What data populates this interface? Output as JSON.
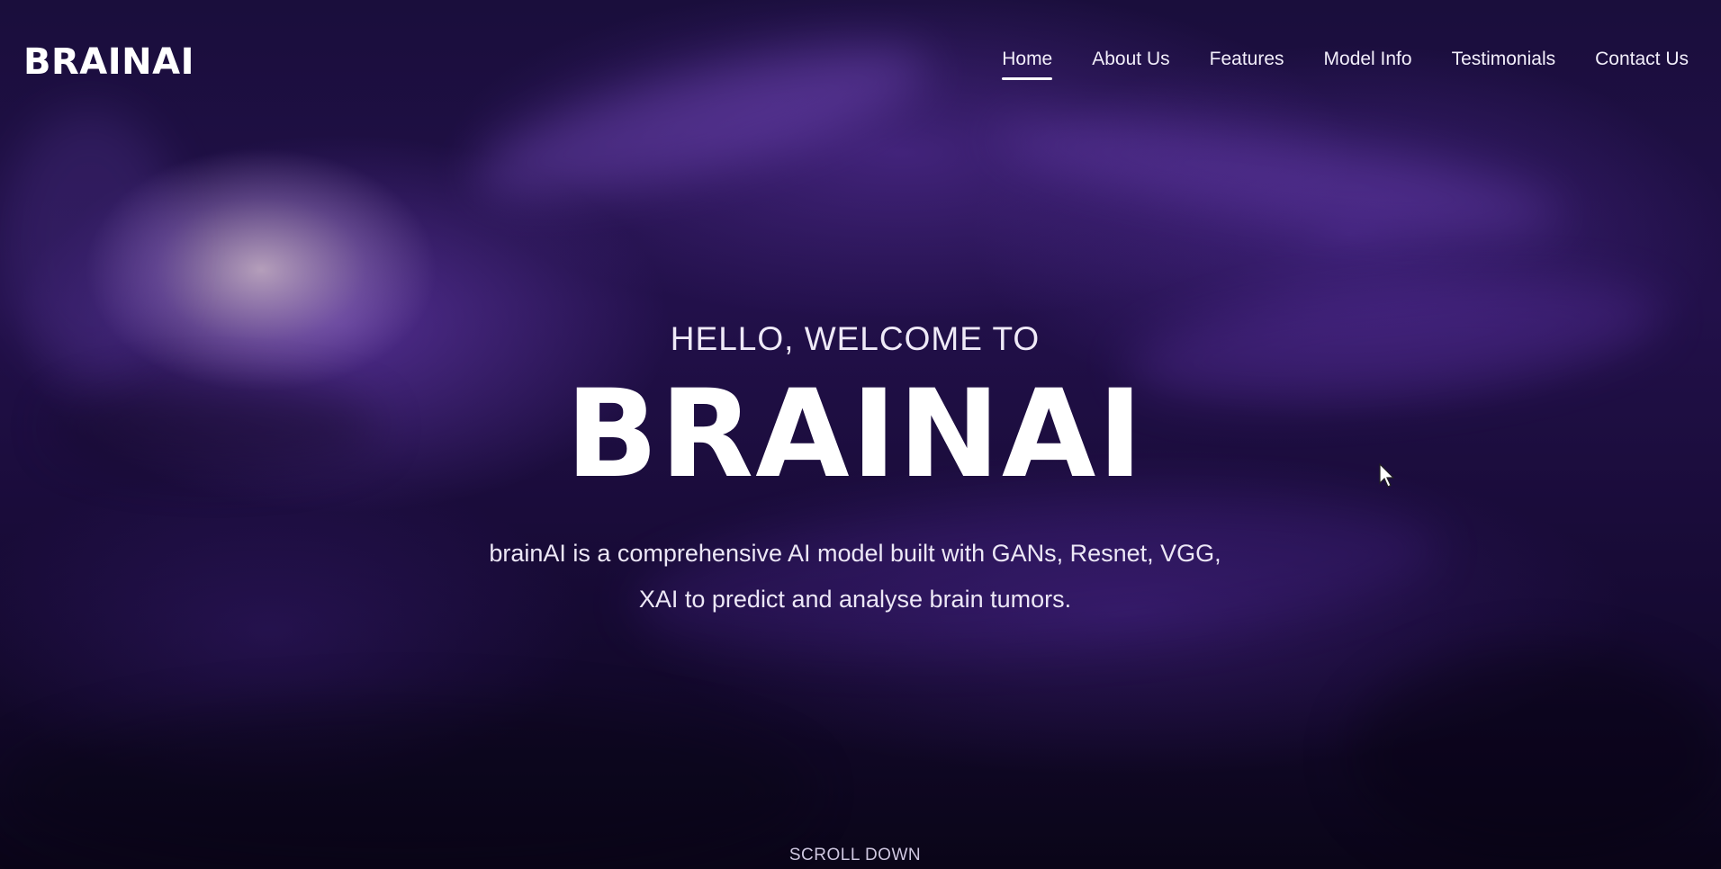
{
  "brand": {
    "logo_text": "BRAINAI"
  },
  "nav": {
    "items": [
      {
        "label": "Home",
        "active": true
      },
      {
        "label": "About Us",
        "active": false
      },
      {
        "label": "Features",
        "active": false
      },
      {
        "label": "Model Info",
        "active": false
      },
      {
        "label": "Testimonials",
        "active": false
      },
      {
        "label": "Contact Us",
        "active": false
      }
    ]
  },
  "hero": {
    "eyebrow": "HELLO, WELCOME TO",
    "title": "BRAINAI",
    "tagline_line1": "brainAI is a comprehensive AI model built with GANs, Resnet, VGG,",
    "tagline_line2": "XAI to predict and analyse brain tumors.",
    "scroll_label": "SCROLL DOWN"
  },
  "colors": {
    "background": "#1a0e3c",
    "accent": "#7a4fd0",
    "text": "#ffffff"
  }
}
